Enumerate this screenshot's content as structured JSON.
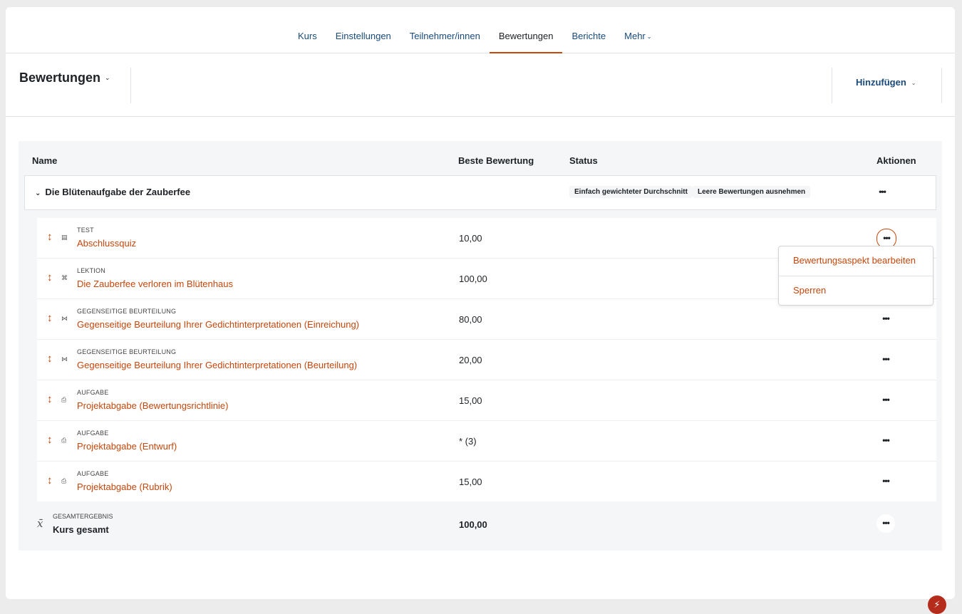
{
  "nav": {
    "tabs": [
      {
        "label": "Kurs"
      },
      {
        "label": "Einstellungen"
      },
      {
        "label": "Teilnehmer/innen"
      },
      {
        "label": "Bewertungen"
      },
      {
        "label": "Berichte"
      },
      {
        "label": "Mehr"
      }
    ],
    "active": "Bewertungen"
  },
  "actionbar": {
    "selector_label": "Bewertungen",
    "add_label": "Hinzufügen"
  },
  "table": {
    "headers": {
      "name": "Name",
      "max_grade": "Beste Bewertung",
      "status": "Status",
      "actions": "Aktionen"
    },
    "category": {
      "name": "Die Blütenaufgabe der Zauberfee",
      "badges": [
        "Einfach gewichteter Durchschnitt",
        "Leere Bewertungen ausnehmen"
      ]
    },
    "items": [
      {
        "type": "TEST",
        "name": "Abschlussquiz",
        "grade": "10,00",
        "icon": "quiz-icon"
      },
      {
        "type": "LEKTION",
        "name": "Die Zauberfee verloren im Blütenhaus",
        "grade": "100,00",
        "icon": "lesson-icon"
      },
      {
        "type": "GEGENSEITIGE BEURTEILUNG",
        "name": "Gegenseitige Beurteilung Ihrer Gedichtinterpretationen (Einreichung)",
        "grade": "80,00",
        "icon": "workshop-icon"
      },
      {
        "type": "GEGENSEITIGE BEURTEILUNG",
        "name": "Gegenseitige Beurteilung Ihrer Gedichtinterpretationen (Beurteilung)",
        "grade": "20,00",
        "icon": "workshop-icon"
      },
      {
        "type": "AUFGABE",
        "name": "Projektabgabe (Bewertungsrichtlinie)",
        "grade": "15,00",
        "icon": "assignment-icon"
      },
      {
        "type": "AUFGABE",
        "name": "Projektabgabe (Entwurf)",
        "grade": "* (3)",
        "icon": "assignment-icon"
      },
      {
        "type": "AUFGABE",
        "name": "Projektabgabe (Rubrik)",
        "grade": "15,00",
        "icon": "assignment-icon"
      }
    ],
    "total": {
      "type": "GESAMTERGEBNIS",
      "name": "Kurs gesamt",
      "grade": "100,00"
    }
  },
  "dropdown": {
    "items": [
      "Bewertungsaspekt bearbeiten",
      "Sperren"
    ]
  }
}
